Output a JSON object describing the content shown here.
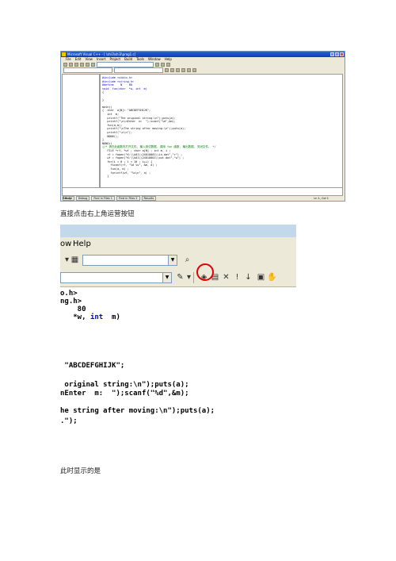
{
  "ide": {
    "title": "Microsoft Visual C++ - [ \\shi3\\shi3\\prog1.c]",
    "menu": [
      "File",
      "Edit",
      "View",
      "Insert",
      "Project",
      "Build",
      "Tools",
      "Window",
      "Help"
    ],
    "code": [
      {
        "t": "#include <stdio.h>",
        "k": "kw"
      },
      {
        "t": "#include <string.h>",
        "k": "kw"
      },
      {
        "t": "#define    N    80",
        "k": "kw"
      },
      {
        "t": "void  fun(char  *w, int  m)",
        "k": "kw"
      },
      {
        "t": "{",
        "k": ""
      },
      {
        "t": "",
        "k": ""
      },
      {
        "t": "}",
        "k": ""
      },
      {
        "t": "",
        "k": ""
      },
      {
        "t": "main()",
        "k": ""
      },
      {
        "t": "{  char  a[N]= \"ABCDEFGHIJK\";",
        "k": ""
      },
      {
        "t": "   int  m;",
        "k": ""
      },
      {
        "t": "   printf(\"The original string:\\n\");puts(a);",
        "k": ""
      },
      {
        "t": "   printf(\"\\n\\nEnter  m:  \");scanf(\"%d\",&m);",
        "k": ""
      },
      {
        "t": "   fun(a,m);",
        "k": ""
      },
      {
        "t": "   printf(\"\\nThe string after moving:\\n\");puts(a);",
        "k": ""
      },
      {
        "t": "   printf(\"\\n\\n\");",
        "k": ""
      },
      {
        "t": "   NONO();",
        "k": ""
      },
      {
        "t": "}",
        "k": ""
      },
      {
        "t": "NONO()",
        "k": ""
      },
      {
        "t": "{/* 请在此函数内打开文件, 输入测试数据, 调用 fun 函数, 输出数据, 关闭文件。 */",
        "k": "cm"
      },
      {
        "t": "   FILE *rf, *wf ; char a[N] ; int m, i ;",
        "k": ""
      },
      {
        "t": "   rf = fopen(\"K:\\\\k01\\\\24010001\\\\in.dat\",\"r\") ;",
        "k": ""
      },
      {
        "t": "   wf = fopen(\"K:\\\\k01\\\\24010001\\\\out.dat\",\"w\") ;",
        "k": ""
      },
      {
        "t": "   for(i = 0 ; i < 10 ; i++) {",
        "k": ""
      },
      {
        "t": "     fscanf(rf, \"%d %s\", &m, a) ;",
        "k": ""
      },
      {
        "t": "     fun(a, m) ;",
        "k": ""
      },
      {
        "t": "     fprintf(wf, \"%s\\n\", a) ;",
        "k": ""
      },
      {
        "t": "   }",
        "k": ""
      }
    ],
    "output_tabs": [
      "Build",
      "Debug",
      "Find in Files 1",
      "Find in Files 2",
      "Results"
    ],
    "status_ready": "Ready",
    "status_pos": "Ln 1, Col 1"
  },
  "caption1": "直接点击右上角运营按钮",
  "toolbar_zoom": {
    "menu_partial": "ow",
    "menu_help": "Help",
    "code_lines": [
      {
        "t": "o.h>"
      },
      {
        "t": "ng.h>"
      },
      {
        "t": "    80"
      },
      {
        "pre": "   *w, ",
        "kw": "int",
        "post": "  m)"
      }
    ]
  },
  "code_zoom": {
    "lines": [
      " \"ABCDEFGHIJK\";",
      "",
      " original string:\\n\");puts(a);",
      "nEnter  m:  \");scanf(\"%d\",&m);",
      "",
      "he string after moving:\\n\");puts(a);",
      ".\");"
    ]
  },
  "caption2": "此时显示的是"
}
